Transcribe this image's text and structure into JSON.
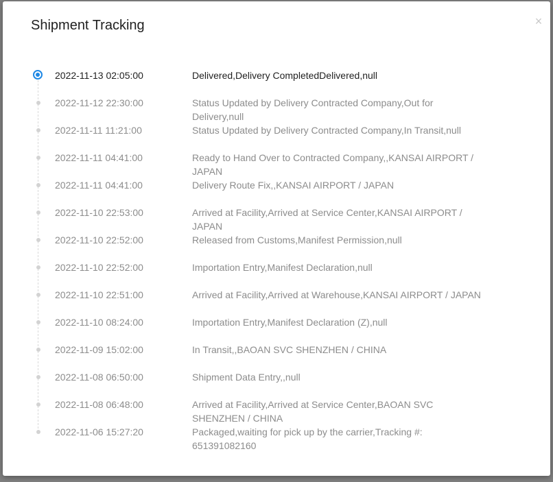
{
  "modal": {
    "title": "Shipment Tracking",
    "close_label": "×"
  },
  "colors": {
    "active_dot": "#1e88e5",
    "inactive_dot": "#d3d3d3",
    "active_text": "#1f1f1f",
    "inactive_text": "#8c8c8c"
  },
  "events": [
    {
      "time": "2022-11-13 02:05:00",
      "description": "Delivered,Delivery CompletedDelivered,null"
    },
    {
      "time": "2022-11-12 22:30:00",
      "description": "Status Updated by Delivery Contracted Company,Out for Delivery,null"
    },
    {
      "time": "2022-11-11 11:21:00",
      "description": "Status Updated by Delivery Contracted Company,In Transit,null"
    },
    {
      "time": "2022-11-11 04:41:00",
      "description": "Ready to Hand Over to Contracted Company,,KANSAI AIRPORT / JAPAN"
    },
    {
      "time": "2022-11-11 04:41:00",
      "description": "Delivery Route Fix,,KANSAI AIRPORT / JAPAN"
    },
    {
      "time": "2022-11-10 22:53:00",
      "description": "Arrived at Facility,Arrived at Service Center,KANSAI AIRPORT / JAPAN"
    },
    {
      "time": "2022-11-10 22:52:00",
      "description": "Released from Customs,Manifest Permission,null"
    },
    {
      "time": "2022-11-10 22:52:00",
      "description": "Importation Entry,Manifest Declaration,null"
    },
    {
      "time": "2022-11-10 22:51:00",
      "description": "Arrived at Facility,Arrived at Warehouse,KANSAI AIRPORT / JAPAN"
    },
    {
      "time": "2022-11-10 08:24:00",
      "description": "Importation Entry,Manifest Declaration (Z),null"
    },
    {
      "time": "2022-11-09 15:02:00",
      "description": "In Transit,,BAOAN SVC SHENZHEN / CHINA"
    },
    {
      "time": "2022-11-08 06:50:00",
      "description": "Shipment Data Entry,,null"
    },
    {
      "time": "2022-11-08 06:48:00",
      "description": "Arrived at Facility,Arrived at Service Center,BAOAN SVC SHENZHEN / CHINA"
    },
    {
      "time": "2022-11-06 15:27:20",
      "description": "Packaged,waiting for pick up by the carrier,Tracking #: 651391082160"
    }
  ]
}
